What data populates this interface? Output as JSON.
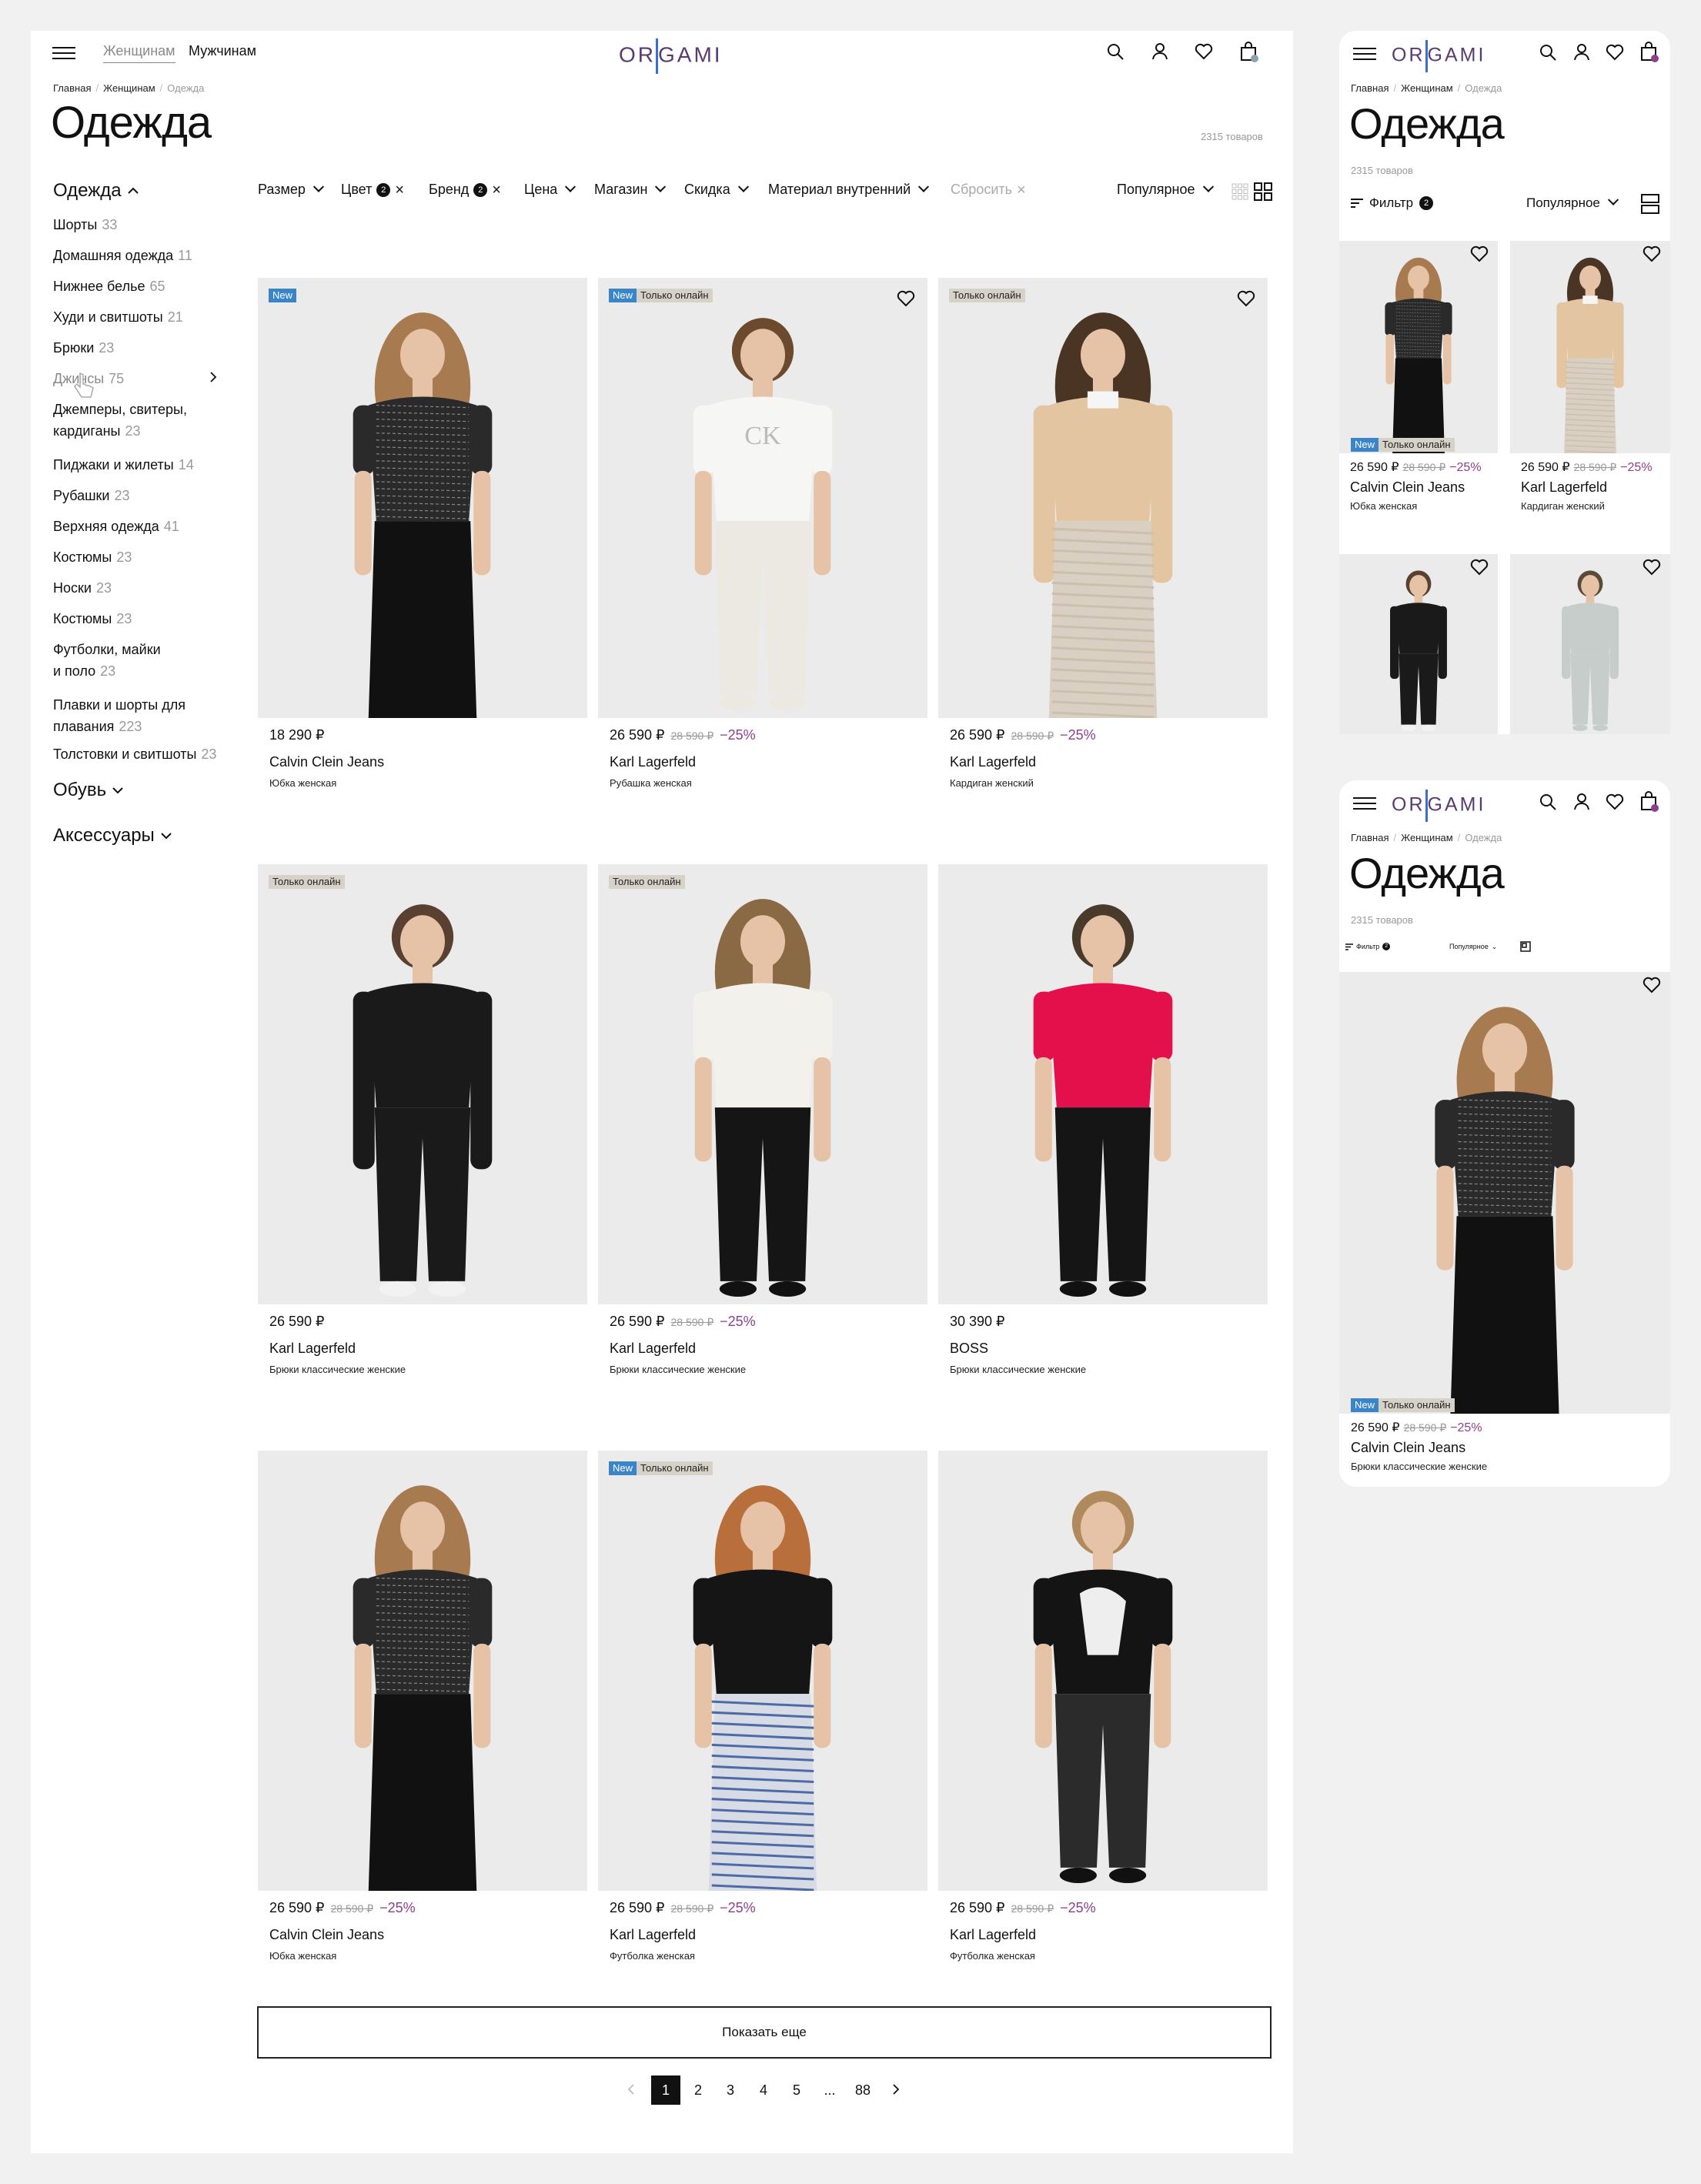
{
  "header": {
    "logo": "ORIGAMI",
    "nav": [
      "Женщинам",
      "Мужчинам"
    ],
    "icons": [
      "search-icon",
      "user-icon",
      "heart-icon",
      "cart-icon"
    ]
  },
  "breadcrumb": [
    "Главная",
    "Женщинам",
    "Одежда"
  ],
  "page_title": "Одежда",
  "total_count": "2315 товаров",
  "sidebar": {
    "sections": [
      {
        "label": "Одежда",
        "expanded": true
      },
      {
        "label": "Обувь",
        "expanded": false
      },
      {
        "label": "Аксессуары",
        "expanded": false
      }
    ],
    "categories": [
      {
        "label": "Шорты",
        "count": "33"
      },
      {
        "label": "Домашняя одежда",
        "count": "11"
      },
      {
        "label": "Нижнее белье",
        "count": "65"
      },
      {
        "label": "Худи и свитшоты",
        "count": "21"
      },
      {
        "label": "Брюки",
        "count": "23"
      },
      {
        "label": "Джинсы",
        "count": "75"
      },
      {
        "label": "Джемперы, свитеры,",
        "label2": "кардиганы",
        "count": "23"
      },
      {
        "label": "Пиджаки и жилеты",
        "count": "14"
      },
      {
        "label": "Рубашки",
        "count": "23"
      },
      {
        "label": "Верхняя одежда",
        "count": "41"
      },
      {
        "label": "Костюмы",
        "count": "23"
      },
      {
        "label": "Носки",
        "count": "23"
      },
      {
        "label": "Костюмы",
        "count": "23"
      },
      {
        "label": "Футболки, майки",
        "label2": "и поло",
        "count": "23"
      },
      {
        "label": "Плавки и шорты для",
        "label2": "плавания",
        "count": "223"
      },
      {
        "label": "Толстовки и свитшоты",
        "count": "23"
      }
    ]
  },
  "filters": {
    "size": "Размер",
    "color": "Цвет",
    "color_count": "2",
    "brand": "Бренд",
    "brand_count": "2",
    "price": "Цена",
    "store": "Магазин",
    "discount": "Скидка",
    "material": "Материал внутренний",
    "reset": "Сбросить",
    "sort": "Популярное"
  },
  "badges": {
    "new": "New",
    "online": "Только онлайн"
  },
  "products": [
    {
      "price": "18 290 ₽",
      "old": "",
      "disc": "",
      "brand": "Calvin Clein Jeans",
      "desc": "Юбка женская",
      "new": true,
      "online": false
    },
    {
      "price": "26 590 ₽",
      "old": "28 590 ₽",
      "disc": "−25%",
      "brand": "Karl Lagerfeld",
      "desc": "Рубашка женская",
      "new": true,
      "online": true
    },
    {
      "price": "26 590 ₽",
      "old": "28 590 ₽",
      "disc": "−25%",
      "brand": "Karl Lagerfeld",
      "desc": "Кардиган женский",
      "new": false,
      "online": true
    },
    {
      "price": "26 590 ₽",
      "old": "",
      "disc": "",
      "brand": "Karl Lagerfeld",
      "desc": "Брюки классические женские",
      "new": false,
      "online": true
    },
    {
      "price": "26 590 ₽",
      "old": "28 590 ₽",
      "disc": "−25%",
      "brand": "Karl Lagerfeld",
      "desc": "Брюки классические женские",
      "new": false,
      "online": true
    },
    {
      "price": "30 390 ₽",
      "old": "",
      "disc": "",
      "brand": "BOSS",
      "desc": "Брюки классические женские",
      "new": false,
      "online": false
    },
    {
      "price": "26 590 ₽",
      "old": "28 590 ₽",
      "disc": "−25%",
      "brand": "Calvin Clein Jeans",
      "desc": "Юбка женская",
      "new": false,
      "online": false
    },
    {
      "price": "26 590 ₽",
      "old": "28 590 ₽",
      "disc": "−25%",
      "brand": "Karl Lagerfeld",
      "desc": "Футболка женская",
      "new": true,
      "online": true
    },
    {
      "price": "26 590 ₽",
      "old": "28 590 ₽",
      "disc": "−25%",
      "brand": "Karl Lagerfeld",
      "desc": "Футболка женская",
      "new": false,
      "online": false
    }
  ],
  "show_more": "Показать еще",
  "pagination": {
    "pages": [
      "1",
      "2",
      "3",
      "4",
      "5",
      "...",
      "88"
    ],
    "current": "1"
  },
  "mobile1": {
    "filter_label": "Фильтр",
    "filter_count": "2",
    "sort": "Популярное",
    "products": [
      {
        "price": "26 590 ₽",
        "old": "28 590 ₽",
        "disc": "−25%",
        "brand": "Calvin Clein Jeans",
        "desc": "Юбка женская"
      },
      {
        "price": "26 590 ₽",
        "old": "28 590 ₽",
        "disc": "−25%",
        "brand": "Karl Lagerfeld",
        "desc": "Кардиган женский"
      }
    ]
  },
  "mobile2": {
    "filter_label": "Фильтр",
    "filter_count": "2",
    "sort": "Популярное",
    "product": {
      "price": "26 590 ₽",
      "old": "28 590 ₽",
      "disc": "−25%",
      "brand": "Calvin Clein Jeans",
      "desc": "Брюки классические женские"
    }
  }
}
